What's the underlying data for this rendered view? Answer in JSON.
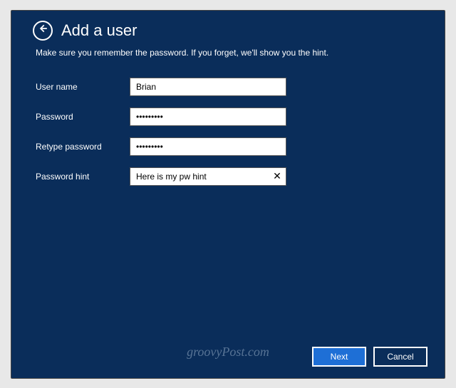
{
  "header": {
    "title": "Add a user",
    "subtitle": "Make sure you remember the password. If you forget, we'll show you the hint."
  },
  "form": {
    "username": {
      "label": "User name",
      "value": "Brian"
    },
    "password": {
      "label": "Password",
      "value": "•••••••••"
    },
    "retype": {
      "label": "Retype password",
      "value": "•••••••••"
    },
    "hint": {
      "label": "Password hint",
      "value": "Here is my pw hint"
    }
  },
  "buttons": {
    "next": "Next",
    "cancel": "Cancel"
  },
  "watermark": "groovyPost.com",
  "icons": {
    "clear": "✕"
  }
}
